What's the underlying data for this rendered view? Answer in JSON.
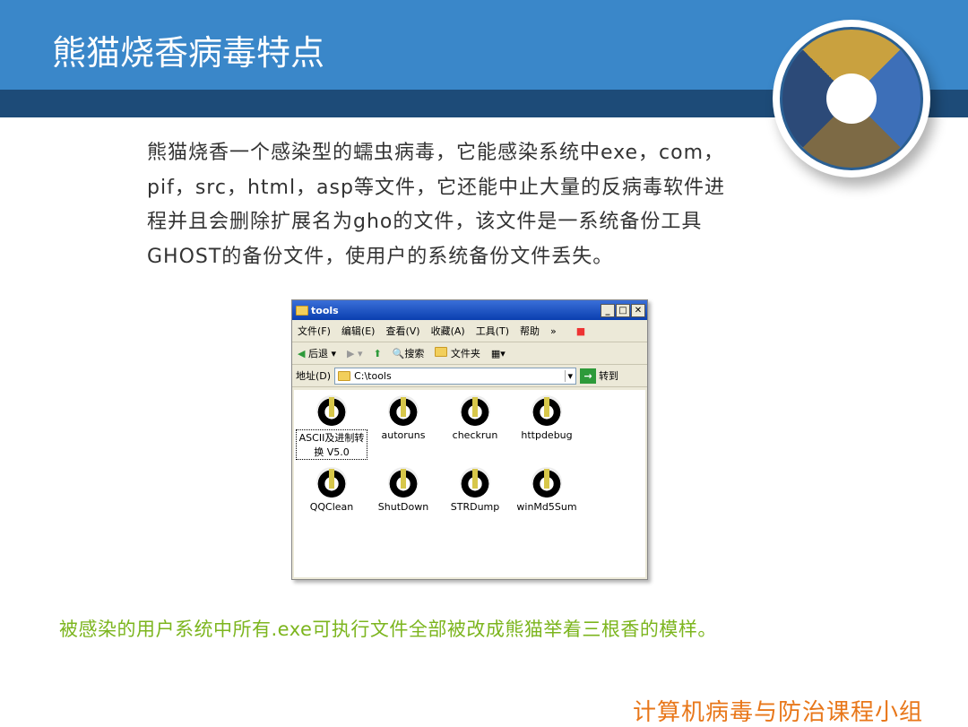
{
  "slide": {
    "title": "熊猫烧香病毒特点",
    "body_lines": [
      "熊猫烧香一个感染型的蠕虫病毒，它能感染系统中exe，com，",
      "pif，src，html，asp等文件，它还能中止大量的反病毒软件进",
      "程并且会删除扩展名为gho的文件，该文件是一系统备份工具",
      "GHOST的备份文件，使用户的系统备份文件丢失。"
    ],
    "note": "被感染的用户系统中所有.exe可执行文件全部被改成熊猫举着三根香的模样。",
    "footer": "计算机病毒与防治课程小组",
    "colors": {
      "header": "#3a87c9",
      "band": "#1d4b78",
      "note": "#7cb51e",
      "footer": "#e8771a"
    }
  },
  "window": {
    "title": "tools",
    "menu": [
      "文件(F)",
      "编辑(E)",
      "查看(V)",
      "收藏(A)",
      "工具(T)",
      "帮助",
      "»"
    ],
    "toolbar": {
      "back": "后退",
      "search": "搜索",
      "folders": "文件夹"
    },
    "address": {
      "label": "地址(D)",
      "value": "C:\\tools",
      "go": "转到"
    },
    "files": [
      "ASCII及进制转换 V5.0",
      "autoruns",
      "checkrun",
      "httpdebug",
      "QQClean",
      "ShutDown",
      "STRDump",
      "winMd5Sum"
    ]
  }
}
